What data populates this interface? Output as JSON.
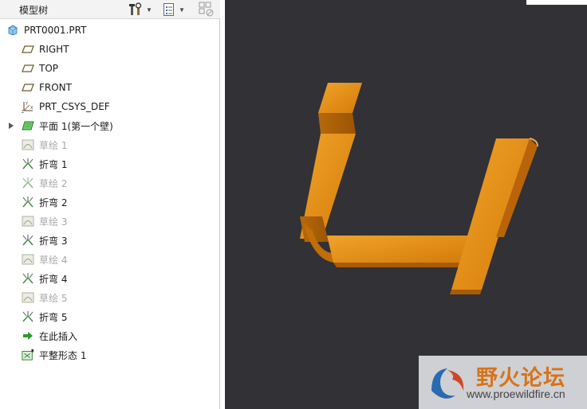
{
  "panel": {
    "title": "模型树"
  },
  "tree": {
    "root": "PRT0001.PRT",
    "items": [
      {
        "label": "RIGHT",
        "icon": "datum-plane-icon",
        "dim": false
      },
      {
        "label": "TOP",
        "icon": "datum-plane-icon",
        "dim": false
      },
      {
        "label": "FRONT",
        "icon": "datum-plane-icon",
        "dim": false
      },
      {
        "label": "PRT_CSYS_DEF",
        "icon": "csys-icon",
        "dim": false
      },
      {
        "label": "平面 1(第一个壁)",
        "icon": "flat-wall-icon",
        "dim": false
      },
      {
        "label": "草绘 1",
        "icon": "sketch-icon",
        "dim": true
      },
      {
        "label": "折弯 1",
        "icon": "bend-icon",
        "dim": false
      },
      {
        "label": "草绘 2",
        "icon": "sketch-icon",
        "dim": true
      },
      {
        "label": "折弯 2",
        "icon": "bend-icon",
        "dim": false
      },
      {
        "label": "草绘 3",
        "icon": "sketch-icon",
        "dim": true
      },
      {
        "label": "折弯 3",
        "icon": "bend-icon",
        "dim": false
      },
      {
        "label": "草绘 4",
        "icon": "sketch-icon",
        "dim": true
      },
      {
        "label": "折弯 4",
        "icon": "bend-icon",
        "dim": false
      },
      {
        "label": "草绘 5",
        "icon": "sketch-icon",
        "dim": true
      },
      {
        "label": "折弯 5",
        "icon": "bend-icon",
        "dim": false
      },
      {
        "label": "在此插入",
        "icon": "insert-here-arrow-icon",
        "dim": false
      },
      {
        "label": "平整形态 1",
        "icon": "flat-pattern-icon",
        "dim": false
      }
    ]
  },
  "watermark": {
    "title": "野火论坛",
    "url": "www.proewildfire.cn"
  },
  "colors": {
    "viewport_bg": "#313136",
    "part_orange": "#e08a0c"
  }
}
